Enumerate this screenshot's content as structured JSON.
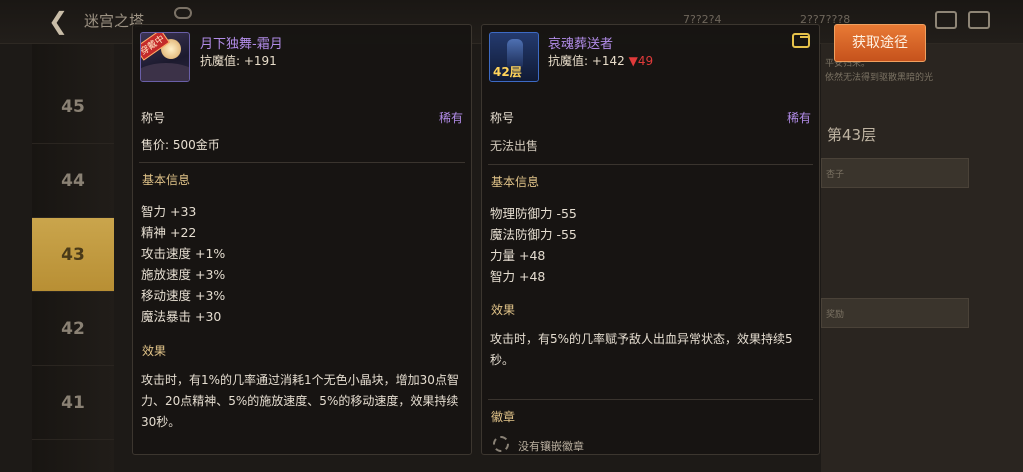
{
  "background": {
    "title": "迷宫之塔",
    "floors": [
      "45",
      "44",
      "43",
      "42",
      "41"
    ],
    "active_floor": "43",
    "resources": [
      "7??2?4",
      "2??7???8"
    ],
    "right_panel": {
      "floor_title": "第43层",
      "line1": "平安归来。",
      "line2": "依然无法得到驱散黑暗的光",
      "item_label": "杏子",
      "reward_label": "奖励"
    }
  },
  "left_card": {
    "badge": "穿戴中",
    "name": "月下独舞-霜月",
    "resistance": "抗魔值: +191",
    "type_label": "称号",
    "rarity": "稀有",
    "price": "售价: 500金币",
    "basic_title": "基本信息",
    "stats": [
      "智力 +33",
      "精神 +22",
      "攻击速度 +1%",
      "施放速度 +3%",
      "移动速度 +3%",
      "魔法暴击 +30"
    ],
    "effect_title": "效果",
    "effect_text": "攻击时，有1%的几率通过消耗1个无色小晶块，增加30点智力、20点精神、5%的施放速度、5%的移动速度，效果持续30秒。"
  },
  "right_card": {
    "icon_floor": "42层",
    "name": "哀魂葬送者",
    "resistance": "抗魔值: +142",
    "resistance_diff": "▼49",
    "type_label": "称号",
    "rarity": "稀有",
    "sell_status": "无法出售",
    "basic_title": "基本信息",
    "stats": [
      "物理防御力 -55",
      "魔法防御力 -55",
      "力量 +48",
      "智力 +48"
    ],
    "effect_title": "效果",
    "effect_text": "攻击时，有5%的几率赋予敌人出血异常状态，效果持续5秒。",
    "emblem_title": "徽章",
    "emblem_text": "没有镶嵌徽章"
  },
  "obtain_button": "获取途径",
  "colors": {
    "rare_purple": "#b28ce8",
    "section_gold": "#e2c489",
    "button_orange": "#d8642a",
    "down_red": "#e03a3a"
  }
}
